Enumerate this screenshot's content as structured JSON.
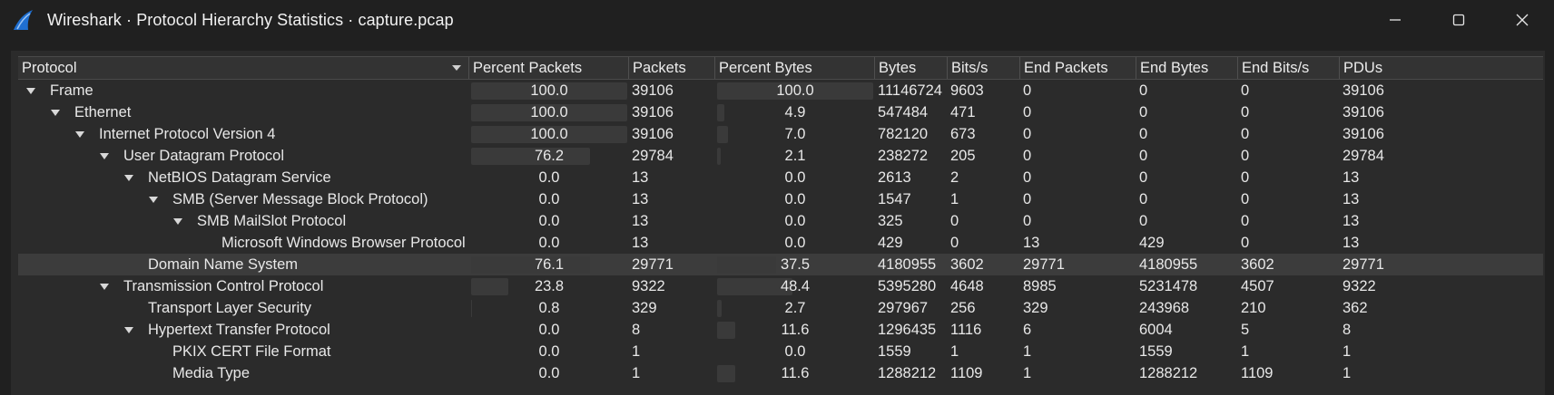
{
  "window": {
    "title": "Wireshark · Protocol Hierarchy Statistics · capture.pcap",
    "icon": "wireshark-fin-icon",
    "controls": [
      "minimize-icon",
      "maximize-icon",
      "close-icon"
    ]
  },
  "colors": {
    "background": "#202020",
    "panel": "#2b2b2b",
    "bar": "#3a3a3a",
    "selected_row": "#3c3c3c",
    "icon_blue": "#1f6fd1"
  },
  "columns": {
    "protocol": "Protocol",
    "percent_packets": "Percent Packets",
    "packets": "Packets",
    "percent_bytes": "Percent Bytes",
    "bytes": "Bytes",
    "bits_s": "Bits/s",
    "end_packets": "End Packets",
    "end_bytes": "End Bytes",
    "end_bits_s": "End Bits/s",
    "pdus": "PDUs"
  },
  "rows": [
    {
      "protocol": "Frame",
      "depth": 0,
      "expandable": true,
      "percent_packets": "100.0",
      "pp": 100.0,
      "packets": "39106",
      "percent_bytes": "100.0",
      "pb": 100.0,
      "bytes": "11146724",
      "bits_s": "9603",
      "end_packets": "0",
      "end_bytes": "0",
      "end_bits_s": "0",
      "pdus": "39106",
      "selected": false
    },
    {
      "protocol": "Ethernet",
      "depth": 1,
      "expandable": true,
      "percent_packets": "100.0",
      "pp": 100.0,
      "packets": "39106",
      "percent_bytes": "4.9",
      "pb": 4.9,
      "bytes": "547484",
      "bits_s": "471",
      "end_packets": "0",
      "end_bytes": "0",
      "end_bits_s": "0",
      "pdus": "39106",
      "selected": false
    },
    {
      "protocol": "Internet Protocol Version 4",
      "depth": 2,
      "expandable": true,
      "percent_packets": "100.0",
      "pp": 100.0,
      "packets": "39106",
      "percent_bytes": "7.0",
      "pb": 7.0,
      "bytes": "782120",
      "bits_s": "673",
      "end_packets": "0",
      "end_bytes": "0",
      "end_bits_s": "0",
      "pdus": "39106",
      "selected": false
    },
    {
      "protocol": "User Datagram Protocol",
      "depth": 3,
      "expandable": true,
      "percent_packets": "76.2",
      "pp": 76.2,
      "packets": "29784",
      "percent_bytes": "2.1",
      "pb": 2.1,
      "bytes": "238272",
      "bits_s": "205",
      "end_packets": "0",
      "end_bytes": "0",
      "end_bits_s": "0",
      "pdus": "29784",
      "selected": false
    },
    {
      "protocol": "NetBIOS Datagram Service",
      "depth": 4,
      "expandable": true,
      "percent_packets": "0.0",
      "pp": 0.0,
      "packets": "13",
      "percent_bytes": "0.0",
      "pb": 0.0,
      "bytes": "2613",
      "bits_s": "2",
      "end_packets": "0",
      "end_bytes": "0",
      "end_bits_s": "0",
      "pdus": "13",
      "selected": false
    },
    {
      "protocol": "SMB (Server Message Block Protocol)",
      "depth": 5,
      "expandable": true,
      "percent_packets": "0.0",
      "pp": 0.0,
      "packets": "13",
      "percent_bytes": "0.0",
      "pb": 0.0,
      "bytes": "1547",
      "bits_s": "1",
      "end_packets": "0",
      "end_bytes": "0",
      "end_bits_s": "0",
      "pdus": "13",
      "selected": false
    },
    {
      "protocol": "SMB MailSlot Protocol",
      "depth": 6,
      "expandable": true,
      "percent_packets": "0.0",
      "pp": 0.0,
      "packets": "13",
      "percent_bytes": "0.0",
      "pb": 0.0,
      "bytes": "325",
      "bits_s": "0",
      "end_packets": "0",
      "end_bytes": "0",
      "end_bits_s": "0",
      "pdus": "13",
      "selected": false
    },
    {
      "protocol": "Microsoft Windows Browser Protocol",
      "depth": 7,
      "expandable": false,
      "percent_packets": "0.0",
      "pp": 0.0,
      "packets": "13",
      "percent_bytes": "0.0",
      "pb": 0.0,
      "bytes": "429",
      "bits_s": "0",
      "end_packets": "13",
      "end_bytes": "429",
      "end_bits_s": "0",
      "pdus": "13",
      "selected": false
    },
    {
      "protocol": "Domain Name System",
      "depth": 4,
      "expandable": false,
      "percent_packets": "76.1",
      "pp": 76.1,
      "packets": "29771",
      "percent_bytes": "37.5",
      "pb": 37.5,
      "bytes": "4180955",
      "bits_s": "3602",
      "end_packets": "29771",
      "end_bytes": "4180955",
      "end_bits_s": "3602",
      "pdus": "29771",
      "selected": true
    },
    {
      "protocol": "Transmission Control Protocol",
      "depth": 3,
      "expandable": true,
      "percent_packets": "23.8",
      "pp": 23.8,
      "packets": "9322",
      "percent_bytes": "48.4",
      "pb": 48.4,
      "bytes": "5395280",
      "bits_s": "4648",
      "end_packets": "8985",
      "end_bytes": "5231478",
      "end_bits_s": "4507",
      "pdus": "9322",
      "selected": false
    },
    {
      "protocol": "Transport Layer Security",
      "depth": 4,
      "expandable": false,
      "percent_packets": "0.8",
      "pp": 0.8,
      "packets": "329",
      "percent_bytes": "2.7",
      "pb": 2.7,
      "bytes": "297967",
      "bits_s": "256",
      "end_packets": "329",
      "end_bytes": "243968",
      "end_bits_s": "210",
      "pdus": "362",
      "selected": false
    },
    {
      "protocol": "Hypertext Transfer Protocol",
      "depth": 4,
      "expandable": true,
      "percent_packets": "0.0",
      "pp": 0.0,
      "packets": "8",
      "percent_bytes": "11.6",
      "pb": 11.6,
      "bytes": "1296435",
      "bits_s": "1116",
      "end_packets": "6",
      "end_bytes": "6004",
      "end_bits_s": "5",
      "pdus": "8",
      "selected": false
    },
    {
      "protocol": "PKIX CERT File Format",
      "depth": 5,
      "expandable": false,
      "percent_packets": "0.0",
      "pp": 0.0,
      "packets": "1",
      "percent_bytes": "0.0",
      "pb": 0.0,
      "bytes": "1559",
      "bits_s": "1",
      "end_packets": "1",
      "end_bytes": "1559",
      "end_bits_s": "1",
      "pdus": "1",
      "selected": false
    },
    {
      "protocol": "Media Type",
      "depth": 5,
      "expandable": false,
      "percent_packets": "0.0",
      "pp": 0.0,
      "packets": "1",
      "percent_bytes": "11.6",
      "pb": 11.6,
      "bytes": "1288212",
      "bits_s": "1109",
      "end_packets": "1",
      "end_bytes": "1288212",
      "end_bits_s": "1109",
      "pdus": "1",
      "selected": false
    }
  ]
}
